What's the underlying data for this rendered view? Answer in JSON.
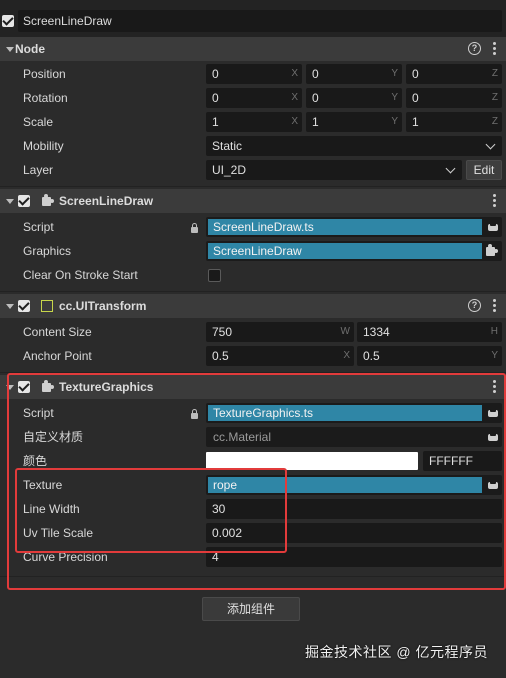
{
  "node_name": "ScreenLineDraw",
  "node_section": {
    "title": "Node",
    "position": {
      "label": "Position",
      "x": "0",
      "y": "0",
      "z": "0",
      "axes": [
        "X",
        "Y",
        "Z"
      ]
    },
    "rotation": {
      "label": "Rotation",
      "x": "0",
      "y": "0",
      "z": "0",
      "axes": [
        "X",
        "Y",
        "Z"
      ]
    },
    "scale": {
      "label": "Scale",
      "x": "1",
      "y": "1",
      "z": "1",
      "axes": [
        "X",
        "Y",
        "Z"
      ]
    },
    "mobility": {
      "label": "Mobility",
      "value": "Static"
    },
    "layer": {
      "label": "Layer",
      "value": "UI_2D",
      "edit_label": "Edit"
    }
  },
  "screenlinedraw_section": {
    "title": "ScreenLineDraw",
    "script": {
      "label": "Script",
      "value": "ScreenLineDraw.ts"
    },
    "graphics": {
      "label": "Graphics",
      "value": "ScreenLineDraw"
    },
    "clear_on_stroke": {
      "label": "Clear On Stroke Start",
      "checked": false
    }
  },
  "uitransform_section": {
    "title": "cc.UITransform",
    "content_size": {
      "label": "Content Size",
      "w": "750",
      "h": "1334",
      "axes": [
        "W",
        "H"
      ]
    },
    "anchor_point": {
      "label": "Anchor Point",
      "x": "0.5",
      "y": "0.5",
      "axes": [
        "X",
        "Y"
      ]
    }
  },
  "texturegraphics_section": {
    "title": "TextureGraphics",
    "script": {
      "label": "Script",
      "value": "TextureGraphics.ts"
    },
    "material": {
      "label": "自定义材质",
      "value": "cc.Material"
    },
    "color": {
      "label": "颜色",
      "hex": "FFFFFF",
      "swatch": "#ffffff"
    },
    "texture": {
      "label": "Texture",
      "value": "rope"
    },
    "line_width": {
      "label": "Line Width",
      "value": "30"
    },
    "uv_tile_scale": {
      "label": "Uv Tile Scale",
      "value": "0.002"
    },
    "curve_precision": {
      "label": "Curve Precision",
      "value": "4"
    }
  },
  "add_component_label": "添加组件",
  "watermark": "掘金技术社区 @ 亿元程序员",
  "colors": {
    "asset_highlight": "#2f86a6",
    "annotation_red": "#e23b3b",
    "panel_bg": "#2b2b2b"
  }
}
